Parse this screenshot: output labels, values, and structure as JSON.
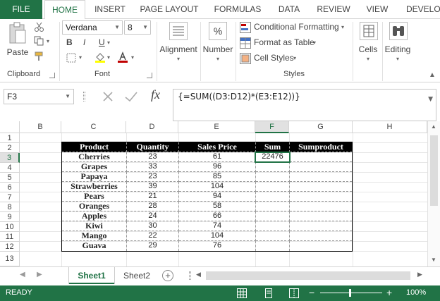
{
  "tabs": {
    "file": "FILE",
    "home": "HOME",
    "insert": "INSERT",
    "page_layout": "PAGE LAYOUT",
    "formulas": "FORMULAS",
    "data": "DATA",
    "review": "REVIEW",
    "view": "VIEW",
    "developer": "DEVELO"
  },
  "ribbon": {
    "clipboard": {
      "paste": "Paste",
      "label": "Clipboard"
    },
    "font": {
      "family": "Verdana",
      "size": "8",
      "bold": "B",
      "italic": "I",
      "underline": "U",
      "label": "Font"
    },
    "alignment": {
      "label": "Alignment"
    },
    "number": {
      "label": "Number",
      "symbol": "%"
    },
    "styles": {
      "conditional": "Conditional Formatting",
      "format_table": "Format as Table",
      "cell_styles": "Cell Styles",
      "label": "Styles"
    },
    "cells": {
      "label": "Cells"
    },
    "editing": {
      "label": "Editing"
    }
  },
  "formula_bar": {
    "name_box": "F3",
    "formula": "{=SUM((D3:D12)*(E3:E12))}",
    "fx": "fx"
  },
  "grid": {
    "columns": [
      "B",
      "C",
      "D",
      "E",
      "F",
      "G",
      "H"
    ],
    "rows": [
      "1",
      "2",
      "3",
      "4",
      "5",
      "6",
      "7",
      "8",
      "9",
      "10",
      "11",
      "12",
      "13"
    ]
  },
  "table": {
    "headers": [
      "Product",
      "Quantity",
      "Sales Price",
      "Sum",
      "Sumproduct"
    ],
    "rows": [
      [
        "Cherries",
        "23",
        "61",
        "22476",
        ""
      ],
      [
        "Grapes",
        "33",
        "96",
        "",
        ""
      ],
      [
        "Papaya",
        "23",
        "85",
        "",
        ""
      ],
      [
        "Strawberries",
        "39",
        "104",
        "",
        ""
      ],
      [
        "Pears",
        "21",
        "94",
        "",
        ""
      ],
      [
        "Oranges",
        "28",
        "58",
        "",
        ""
      ],
      [
        "Apples",
        "24",
        "66",
        "",
        ""
      ],
      [
        "Kiwi",
        "30",
        "74",
        "",
        ""
      ],
      [
        "Mango",
        "22",
        "104",
        "",
        ""
      ],
      [
        "Guava",
        "29",
        "76",
        "",
        ""
      ]
    ]
  },
  "sheets": {
    "sheet1": "Sheet1",
    "sheet2": "Sheet2",
    "add": "+"
  },
  "status": {
    "ready": "READY",
    "zoom": "100%"
  },
  "colors": {
    "excel_green": "#217346",
    "header_black": "#000000"
  }
}
